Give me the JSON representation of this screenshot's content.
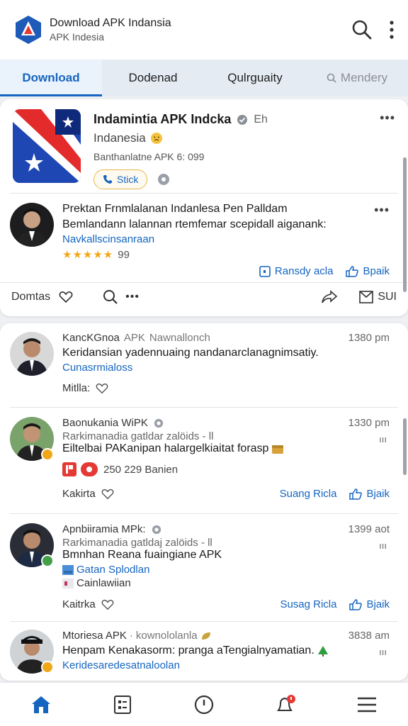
{
  "header": {
    "title": "Download APK Indansia",
    "subtitle": "APK Indesia"
  },
  "tabs": [
    {
      "label": "Download"
    },
    {
      "label": "Dodenad"
    },
    {
      "label": "Qulrguaity"
    },
    {
      "label": "Mendery"
    }
  ],
  "app": {
    "name": "Indamintia APK Indcka",
    "lang": "Eh",
    "region": "Indanesia",
    "version": "Banthanlatne APK 6: 099",
    "stick_label": "Stick"
  },
  "featured_post": {
    "title": "Prektan Frnmlalanan Indanlesa Pen Palldam",
    "text": "Bemlandann lalannan rtemfemar scepidall aiganank:",
    "link": "Navkallscinsanraan",
    "stars": "★★★★★",
    "rating": "99",
    "action_save": "Ransdy acla",
    "action_like": "Bpaik"
  },
  "toolbar": {
    "label": "Domtas",
    "action": "SUI"
  },
  "posts": [
    {
      "title": "KancKGnoa",
      "tag": "APK",
      "meta": "Nawnallonch",
      "time": "1380 pm",
      "text": "Keridansian yadennuaing nandanarclanagnimsatiy.",
      "link": "Cunasrmialoss",
      "footer": "Mitlla:"
    },
    {
      "title": "Baonukania WiPK",
      "meta": "Rarkimanadia gatldar zalöids - ll",
      "time": "1330 pm",
      "text": "Eiltelbai PAKanipan halargelkiaitat forasp",
      "stats": "250 229 Banien",
      "footer": "Kakirta",
      "action_save": "Suang Ricla",
      "action_like": "Bjaik"
    },
    {
      "title": "Apnbiiramia MPk:",
      "meta": "Rarkimanadia gatldaj zalöids - ll",
      "time": "1399 aot",
      "text": "Bmnhan Reana fuaingiane APK",
      "link": "Gatan Splodlan",
      "sub": "Cainlawiian",
      "footer": "Kaitrka",
      "action_save": "Susag Ricla",
      "action_like": "Bjaik"
    },
    {
      "title": "Mtoriesa APK",
      "meta": "kownololanla",
      "time": "3838 am",
      "text": "Henpam Kenakasorm: pranga aTengialnyamatian.",
      "link": "Keridesaredesatnaloolan"
    }
  ],
  "colors": {
    "accent": "#1565c0",
    "star": "#f0a818",
    "notify": "#e53935"
  },
  "icons": [
    "search-icon",
    "more-vert-icon",
    "home-icon",
    "list-icon",
    "clock-icon",
    "bell-icon",
    "menu-icon"
  ]
}
